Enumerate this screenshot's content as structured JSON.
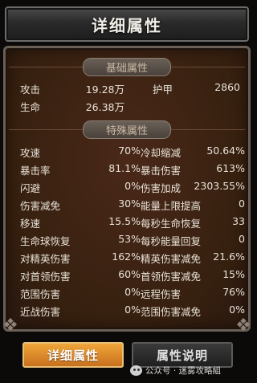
{
  "header": {
    "title": "详细属性"
  },
  "sections": {
    "basic_title": "基础属性",
    "special_title": "特殊属性"
  },
  "basic": [
    {
      "l1": "攻击",
      "v1": "19.28万",
      "l2": "护甲",
      "v2": "2860"
    },
    {
      "l1": "生命",
      "v1": "26.38万",
      "l2": "",
      "v2": ""
    }
  ],
  "special": [
    {
      "l1": "攻速",
      "v1": "70%",
      "l2": "冷却缩减",
      "v2": "50.64%"
    },
    {
      "l1": "暴击率",
      "v1": "81.1%",
      "l2": "暴击伤害",
      "v2": "613%"
    },
    {
      "l1": "闪避",
      "v1": "0%",
      "l2": "伤害加成",
      "v2": "2303.55%"
    },
    {
      "l1": "伤害减免",
      "v1": "30%",
      "l2": "能量上限提高",
      "v2": "0"
    },
    {
      "l1": "移速",
      "v1": "15.5%",
      "l2": "每秒生命恢复",
      "v2": "33"
    },
    {
      "l1": "生命球恢复",
      "v1": "53%",
      "l2": "每秒能量回复",
      "v2": "0"
    },
    {
      "l1": "对精英伤害",
      "v1": "162%",
      "l2": "精英伤害减免",
      "v2": "21.6%"
    },
    {
      "l1": "对首领伤害",
      "v1": "60%",
      "l2": "首领伤害减免",
      "v2": "15%"
    },
    {
      "l1": "范围伤害",
      "v1": "0%",
      "l2": "远程伤害",
      "v2": "76%"
    },
    {
      "l1": "近战伤害",
      "v1": "0%",
      "l2": "范围伤害减免",
      "v2": "0%"
    }
  ],
  "tabs": {
    "details": "详细属性",
    "description": "属性说明"
  },
  "watermark": {
    "text": "公众号 · 迷雾攻略組"
  },
  "colors": {
    "active_tab": "#e08a2a",
    "panel_bg": "#3a2015"
  }
}
